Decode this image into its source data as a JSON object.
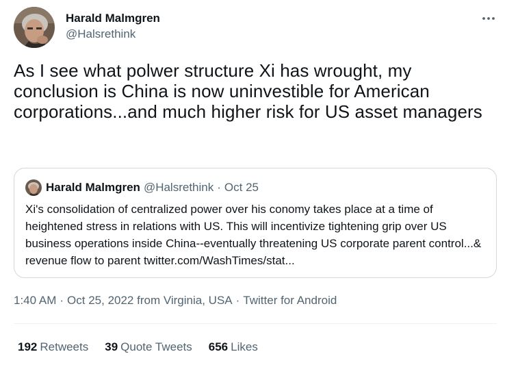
{
  "author": {
    "display_name": "Harald Malmgren",
    "handle": "@Halsrethink"
  },
  "tweet": {
    "text": "As I see what polwer structure Xi has wrought, my conclusion is China is now uninvestible for American corporations...and much higher risk for US asset managers"
  },
  "quoted_tweet": {
    "display_name": "Harald Malmgren",
    "handle": "@Halsrethink",
    "separator": "·",
    "date": "Oct 25",
    "text": "Xi's consolidation of centralized power over his conomy takes place at a time of heightened stress in relations with US. This will incentivize tightening grip over US business operations inside China--eventually threatening US corporate parent control...& revenue flow to parent twitter.com/WashTimes/stat..."
  },
  "meta": {
    "time": "1:40 AM",
    "date": "Oct 25, 2022 from Virginia, USA",
    "source": "Twitter for Android",
    "separator": "·"
  },
  "stats": {
    "retweets_count": "192",
    "retweets_label": "Retweets",
    "quotes_count": "39",
    "quotes_label": "Quote Tweets",
    "likes_count": "656",
    "likes_label": "Likes"
  },
  "icons": {
    "more": "more-horizontal-icon"
  },
  "colors": {
    "text": "#0f1419",
    "secondary": "#536471",
    "border": "#cfd9de",
    "divider": "#eff3f4"
  }
}
